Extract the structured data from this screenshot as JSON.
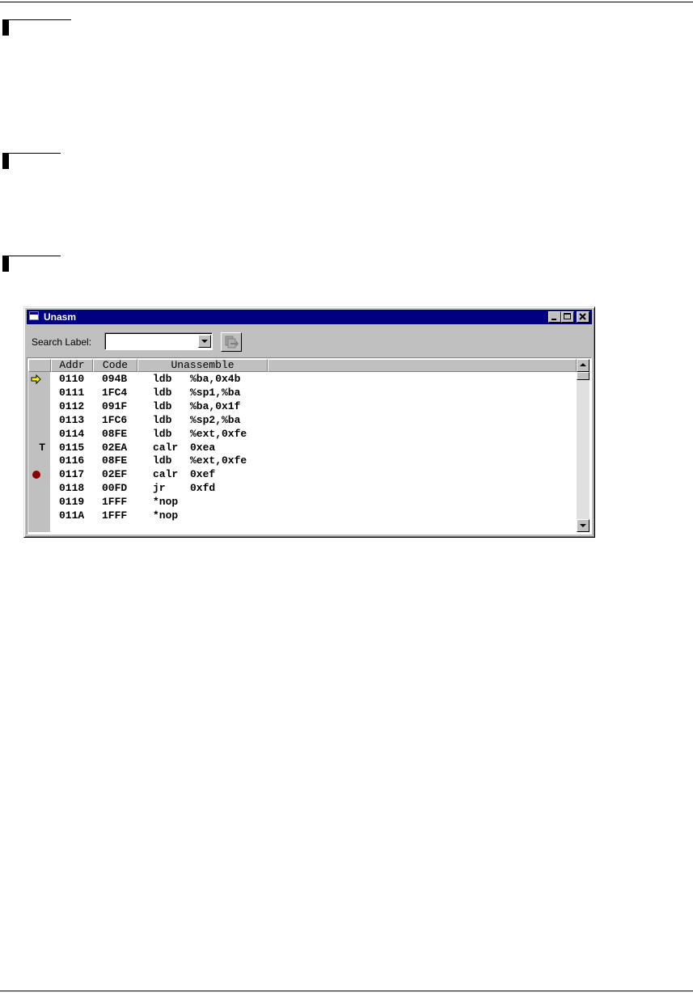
{
  "window": {
    "title": "Unasm"
  },
  "toolbar": {
    "search_label": "Search Label:",
    "search_value": ""
  },
  "grid": {
    "columns": [
      "Addr",
      "Code",
      "Unassemble"
    ],
    "rows": [
      {
        "marker": "current-pc-arrow",
        "addr": "0110",
        "code": "094B",
        "mnemonic": "ldb",
        "operands": "%ba,0x4b"
      },
      {
        "marker": "",
        "addr": "0111",
        "code": "1FC4",
        "mnemonic": "ldb",
        "operands": "%sp1,%ba"
      },
      {
        "marker": "",
        "addr": "0112",
        "code": "091F",
        "mnemonic": "ldb",
        "operands": "%ba,0x1f"
      },
      {
        "marker": "",
        "addr": "0113",
        "code": "1FC6",
        "mnemonic": "ldb",
        "operands": "%sp2,%ba"
      },
      {
        "marker": "",
        "addr": "0114",
        "code": "08FE",
        "mnemonic": "ldb",
        "operands": "%ext,0xfe"
      },
      {
        "marker": "T",
        "addr": "0115",
        "code": "02EA",
        "mnemonic": "calr",
        "operands": "0xea"
      },
      {
        "marker": "",
        "addr": "0116",
        "code": "08FE",
        "mnemonic": "ldb",
        "operands": "%ext,0xfe"
      },
      {
        "marker": "breakpoint",
        "addr": "0117",
        "code": "02EF",
        "mnemonic": "calr",
        "operands": "0xef"
      },
      {
        "marker": "",
        "addr": "0118",
        "code": "00FD",
        "mnemonic": "jr",
        "operands": "0xfd"
      },
      {
        "marker": "",
        "addr": "0119",
        "code": "1FFF",
        "mnemonic": "*nop",
        "operands": ""
      },
      {
        "marker": "",
        "addr": "011A",
        "code": "1FFF",
        "mnemonic": "*nop",
        "operands": ""
      }
    ]
  },
  "colors": {
    "titlebar": "#000080",
    "arrow": "#ffff00",
    "breakpoint": "#8b0000"
  },
  "icons": {
    "window": "window-icon",
    "minimize": "minimize-icon",
    "maximize": "maximize-icon",
    "close": "close-icon",
    "dropdown": "chevron-down-icon",
    "search_go": "search-go-icon",
    "scroll_up": "scroll-up-icon",
    "scroll_down": "scroll-down-icon"
  }
}
